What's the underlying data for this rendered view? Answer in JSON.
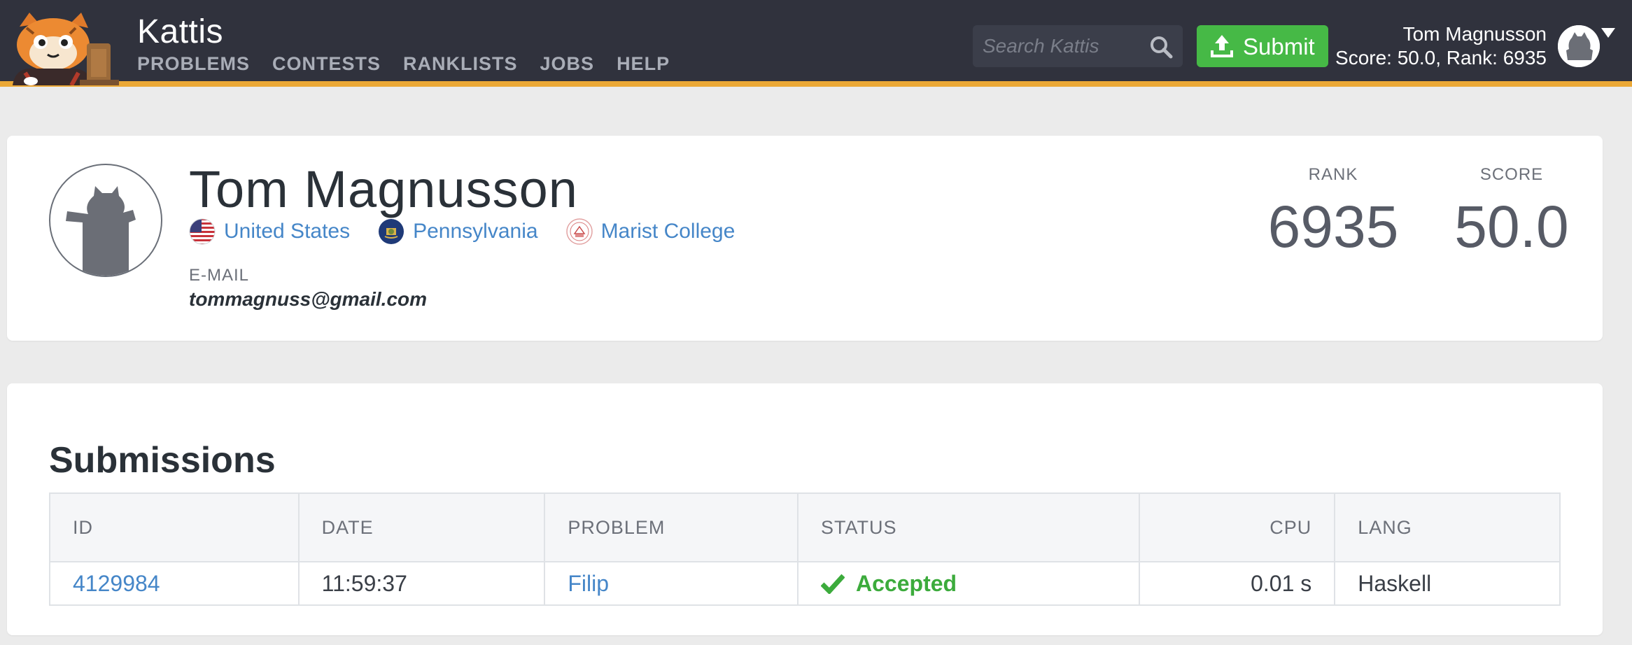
{
  "navbar": {
    "brand": "Kattis",
    "links": [
      "PROBLEMS",
      "CONTESTS",
      "RANKLISTS",
      "JOBS",
      "HELP"
    ],
    "search_placeholder": "Search Kattis",
    "submit_label": "Submit",
    "user_name": "Tom Magnusson",
    "user_stats": "Score: 50.0, Rank: 6935",
    "accent_color": "#eba836",
    "submit_color": "#46b946"
  },
  "profile": {
    "name": "Tom Magnusson",
    "affiliations": [
      {
        "label": "United States",
        "icon": "us-flag-icon"
      },
      {
        "label": "Pennsylvania",
        "icon": "pennsylvania-flag-icon"
      },
      {
        "label": "Marist College",
        "icon": "marist-college-seal-icon"
      }
    ],
    "email_label": "E-MAIL",
    "email": "tommagnuss@gmail.com",
    "rank_label": "RANK",
    "rank": "6935",
    "score_label": "SCORE",
    "score": "50.0"
  },
  "submissions": {
    "title": "Submissions",
    "columns": [
      "ID",
      "DATE",
      "PROBLEM",
      "STATUS",
      "CPU",
      "LANG"
    ],
    "rows": [
      {
        "id": "4129984",
        "date": "11:59:37",
        "problem": "Filip",
        "status": "Accepted",
        "cpu": "0.01 s",
        "lang": "Haskell"
      }
    ],
    "accepted_color": "#3cab3c"
  }
}
